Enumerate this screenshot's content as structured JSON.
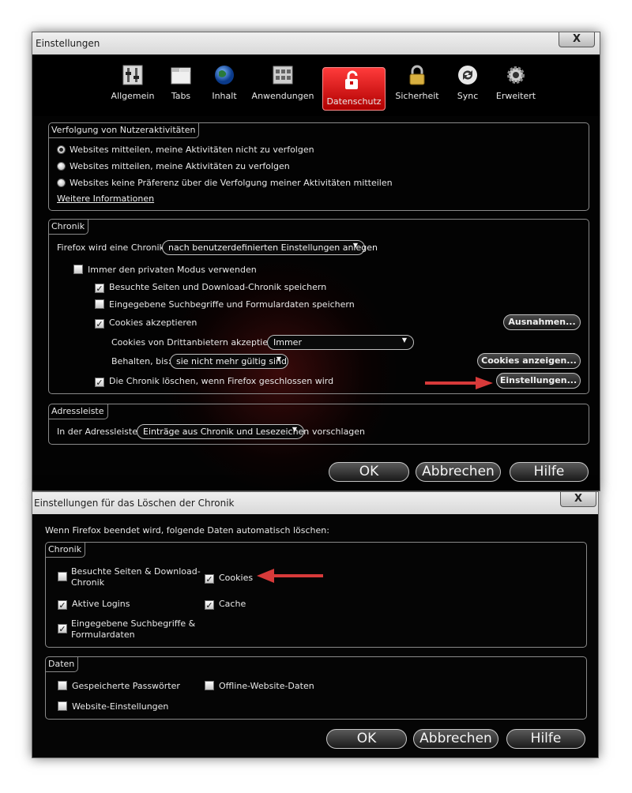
{
  "win1": {
    "title": "Einstellungen",
    "close": "X",
    "toolbar": [
      {
        "label": "Allgemein",
        "icon": "switches-icon"
      },
      {
        "label": "Tabs",
        "icon": "tabs-icon"
      },
      {
        "label": "Inhalt",
        "icon": "globe-icon"
      },
      {
        "label": "Anwendungen",
        "icon": "applications-icon"
      },
      {
        "label": "Datenschutz",
        "icon": "privacy-mask-icon"
      },
      {
        "label": "Sicherheit",
        "icon": "padlock-icon"
      },
      {
        "label": "Sync",
        "icon": "sync-icon"
      },
      {
        "label": "Erweitert",
        "icon": "gear-icon"
      }
    ],
    "active_tab": "Datenschutz",
    "tracking": {
      "legend": "Verfolgung von Nutzeraktivitäten",
      "options": [
        "Websites mitteilen, meine Aktivitäten nicht zu verfolgen",
        "Websites mitteilen, meine Aktivitäten zu verfolgen",
        "Websites keine Präferenz über die Verfolgung meiner Aktivitäten mitteilen"
      ],
      "more_info": "Weitere Informationen"
    },
    "history": {
      "legend": "Chronik",
      "firefox_label": "Firefox wird eine Chronik:",
      "firefox_value": "nach benutzerdefinierten Einstellungen anlegen",
      "private_mode": "Immer den privaten Modus verwenden",
      "remember_history": "Besuchte Seiten und Download-Chronik speichern",
      "remember_search": "Eingegebene Suchbegriffe und Formulardaten speichern",
      "accept_cookies": "Cookies akzeptieren",
      "exceptions_btn": "Ausnahmen...",
      "third_party_label": "Cookies von Drittanbietern akzeptieren:",
      "third_party_value": "Immer",
      "keep_label": "Behalten, bis:",
      "keep_value": "sie nicht mehr gültig sind",
      "show_cookies_btn": "Cookies anzeigen...",
      "clear_on_close": "Die Chronik löschen, wenn Firefox geschlossen wird",
      "settings_btn": "Einstellungen..."
    },
    "urlbar": {
      "legend": "Adressleiste",
      "prefix": "In der Adressleiste",
      "value": "Einträge aus Chronik und Lesezeichen",
      "suffix": "vorschlagen"
    },
    "buttons": {
      "ok": "OK",
      "cancel": "Abbrechen",
      "help": "Hilfe"
    }
  },
  "win2": {
    "title": "Einstellungen für das Löschen der Chronik",
    "close": "X",
    "intro": "Wenn Firefox beendet wird, folgende Daten automatisch löschen:",
    "history": {
      "legend": "Chronik",
      "visited_1": "Besuchte Seiten & Download-",
      "visited_2": "Chronik",
      "cookies": "Cookies",
      "logins": "Aktive Logins",
      "cache": "Cache",
      "search_1": "Eingegebene Suchbegriffe &",
      "search_2": "Formulardaten"
    },
    "data": {
      "legend": "Daten",
      "passwords": "Gespeicherte Passwörter",
      "offline": "Offline-Website-Daten",
      "site_settings": "Website-Einstellungen"
    },
    "buttons": {
      "ok": "OK",
      "cancel": "Abbrechen",
      "help": "Hilfe"
    }
  },
  "check_mark": "✓",
  "dropdown_arrow": "▼",
  "colors": {
    "accent_red": "#e01010",
    "arrow_red": "#d83a3a"
  }
}
